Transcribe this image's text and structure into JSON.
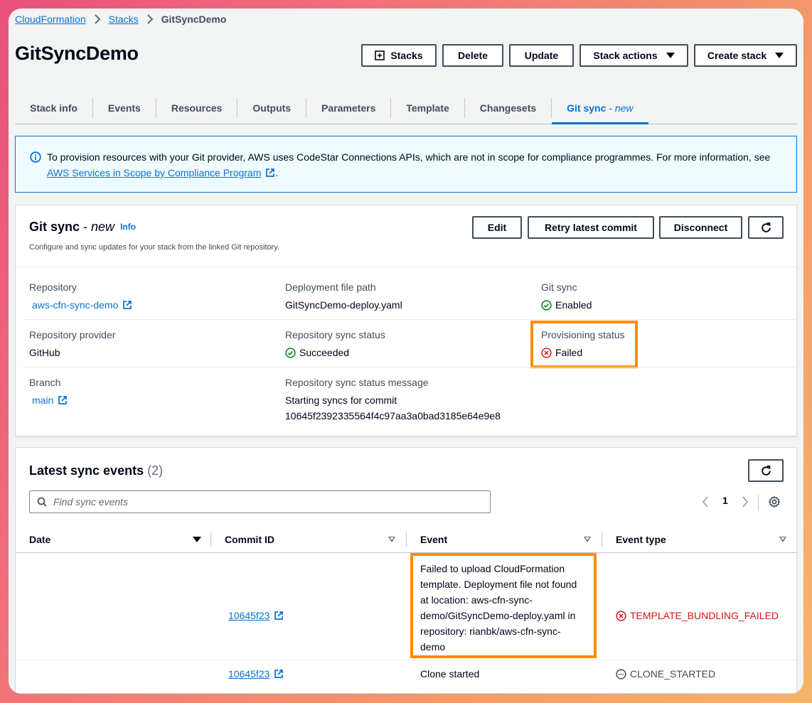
{
  "breadcrumb": {
    "items": [
      "CloudFormation",
      "Stacks"
    ],
    "current": "GitSyncDemo"
  },
  "page_title": "GitSyncDemo",
  "header_buttons": {
    "stacks": "Stacks",
    "delete": "Delete",
    "update": "Update",
    "stack_actions": "Stack actions",
    "create_stack": "Create stack"
  },
  "tabs": [
    "Stack info",
    "Events",
    "Resources",
    "Outputs",
    "Parameters",
    "Template",
    "Changesets"
  ],
  "active_tab": {
    "label": "Git sync",
    "suffix": " - ",
    "badge": "new"
  },
  "notice": {
    "text": "To provision resources with your Git provider, AWS uses CodeStar Connections APIs, which are not in scope for compliance programmes. For more information, see ",
    "link": "AWS Services in Scope by Compliance Program",
    "end": "."
  },
  "git_sync_panel": {
    "title": "Git sync",
    "title_sep": " - ",
    "title_badge": "new",
    "info_link": "Info",
    "description": "Configure and sync updates for your stack from the linked Git repository.",
    "buttons": {
      "edit": "Edit",
      "retry": "Retry latest commit",
      "disconnect": "Disconnect"
    },
    "fields": {
      "repository": {
        "label": "Repository",
        "value": "aws-cfn-sync-demo"
      },
      "deployment_file_path": {
        "label": "Deployment file path",
        "value": "GitSyncDemo-deploy.yaml"
      },
      "git_sync": {
        "label": "Git sync",
        "value": "Enabled"
      },
      "repository_provider": {
        "label": "Repository provider",
        "value": "GitHub"
      },
      "repository_sync_status": {
        "label": "Repository sync status",
        "value": "Succeeded"
      },
      "provisioning_status": {
        "label": "Provisioning status",
        "value": "Failed"
      },
      "branch": {
        "label": "Branch",
        "value": "main"
      },
      "repository_sync_status_message": {
        "label": "Repository sync status message",
        "line1": "Starting syncs for commit",
        "line2": "10645f2392335564f4c97aa3a0bad3185e64e9e8"
      }
    }
  },
  "sync_events": {
    "title": "Latest sync events",
    "count": "(2)",
    "search_placeholder": "Find sync events",
    "page": "1",
    "columns": [
      "Date",
      "Commit ID",
      "Event",
      "Event type"
    ],
    "rows": [
      {
        "date": "",
        "commit": "10645f23",
        "event_lines": [
          "Failed to upload CloudFormation",
          "template. Deployment file not found",
          "at location: aws-cfn-sync-",
          "demo/GitSyncDemo-deploy.yaml in",
          "repository: rianbk/aws-cfn-sync-",
          "demo"
        ],
        "event_type": "TEMPLATE_BUNDLING_FAILED"
      },
      {
        "date": "",
        "commit": "10645f23",
        "event": "Clone started",
        "event_type": "CLONE_STARTED"
      }
    ]
  },
  "colors": {
    "link": "#0972d3",
    "success": "#037f0c",
    "error": "#d91515",
    "highlight": "#ff8c00"
  }
}
